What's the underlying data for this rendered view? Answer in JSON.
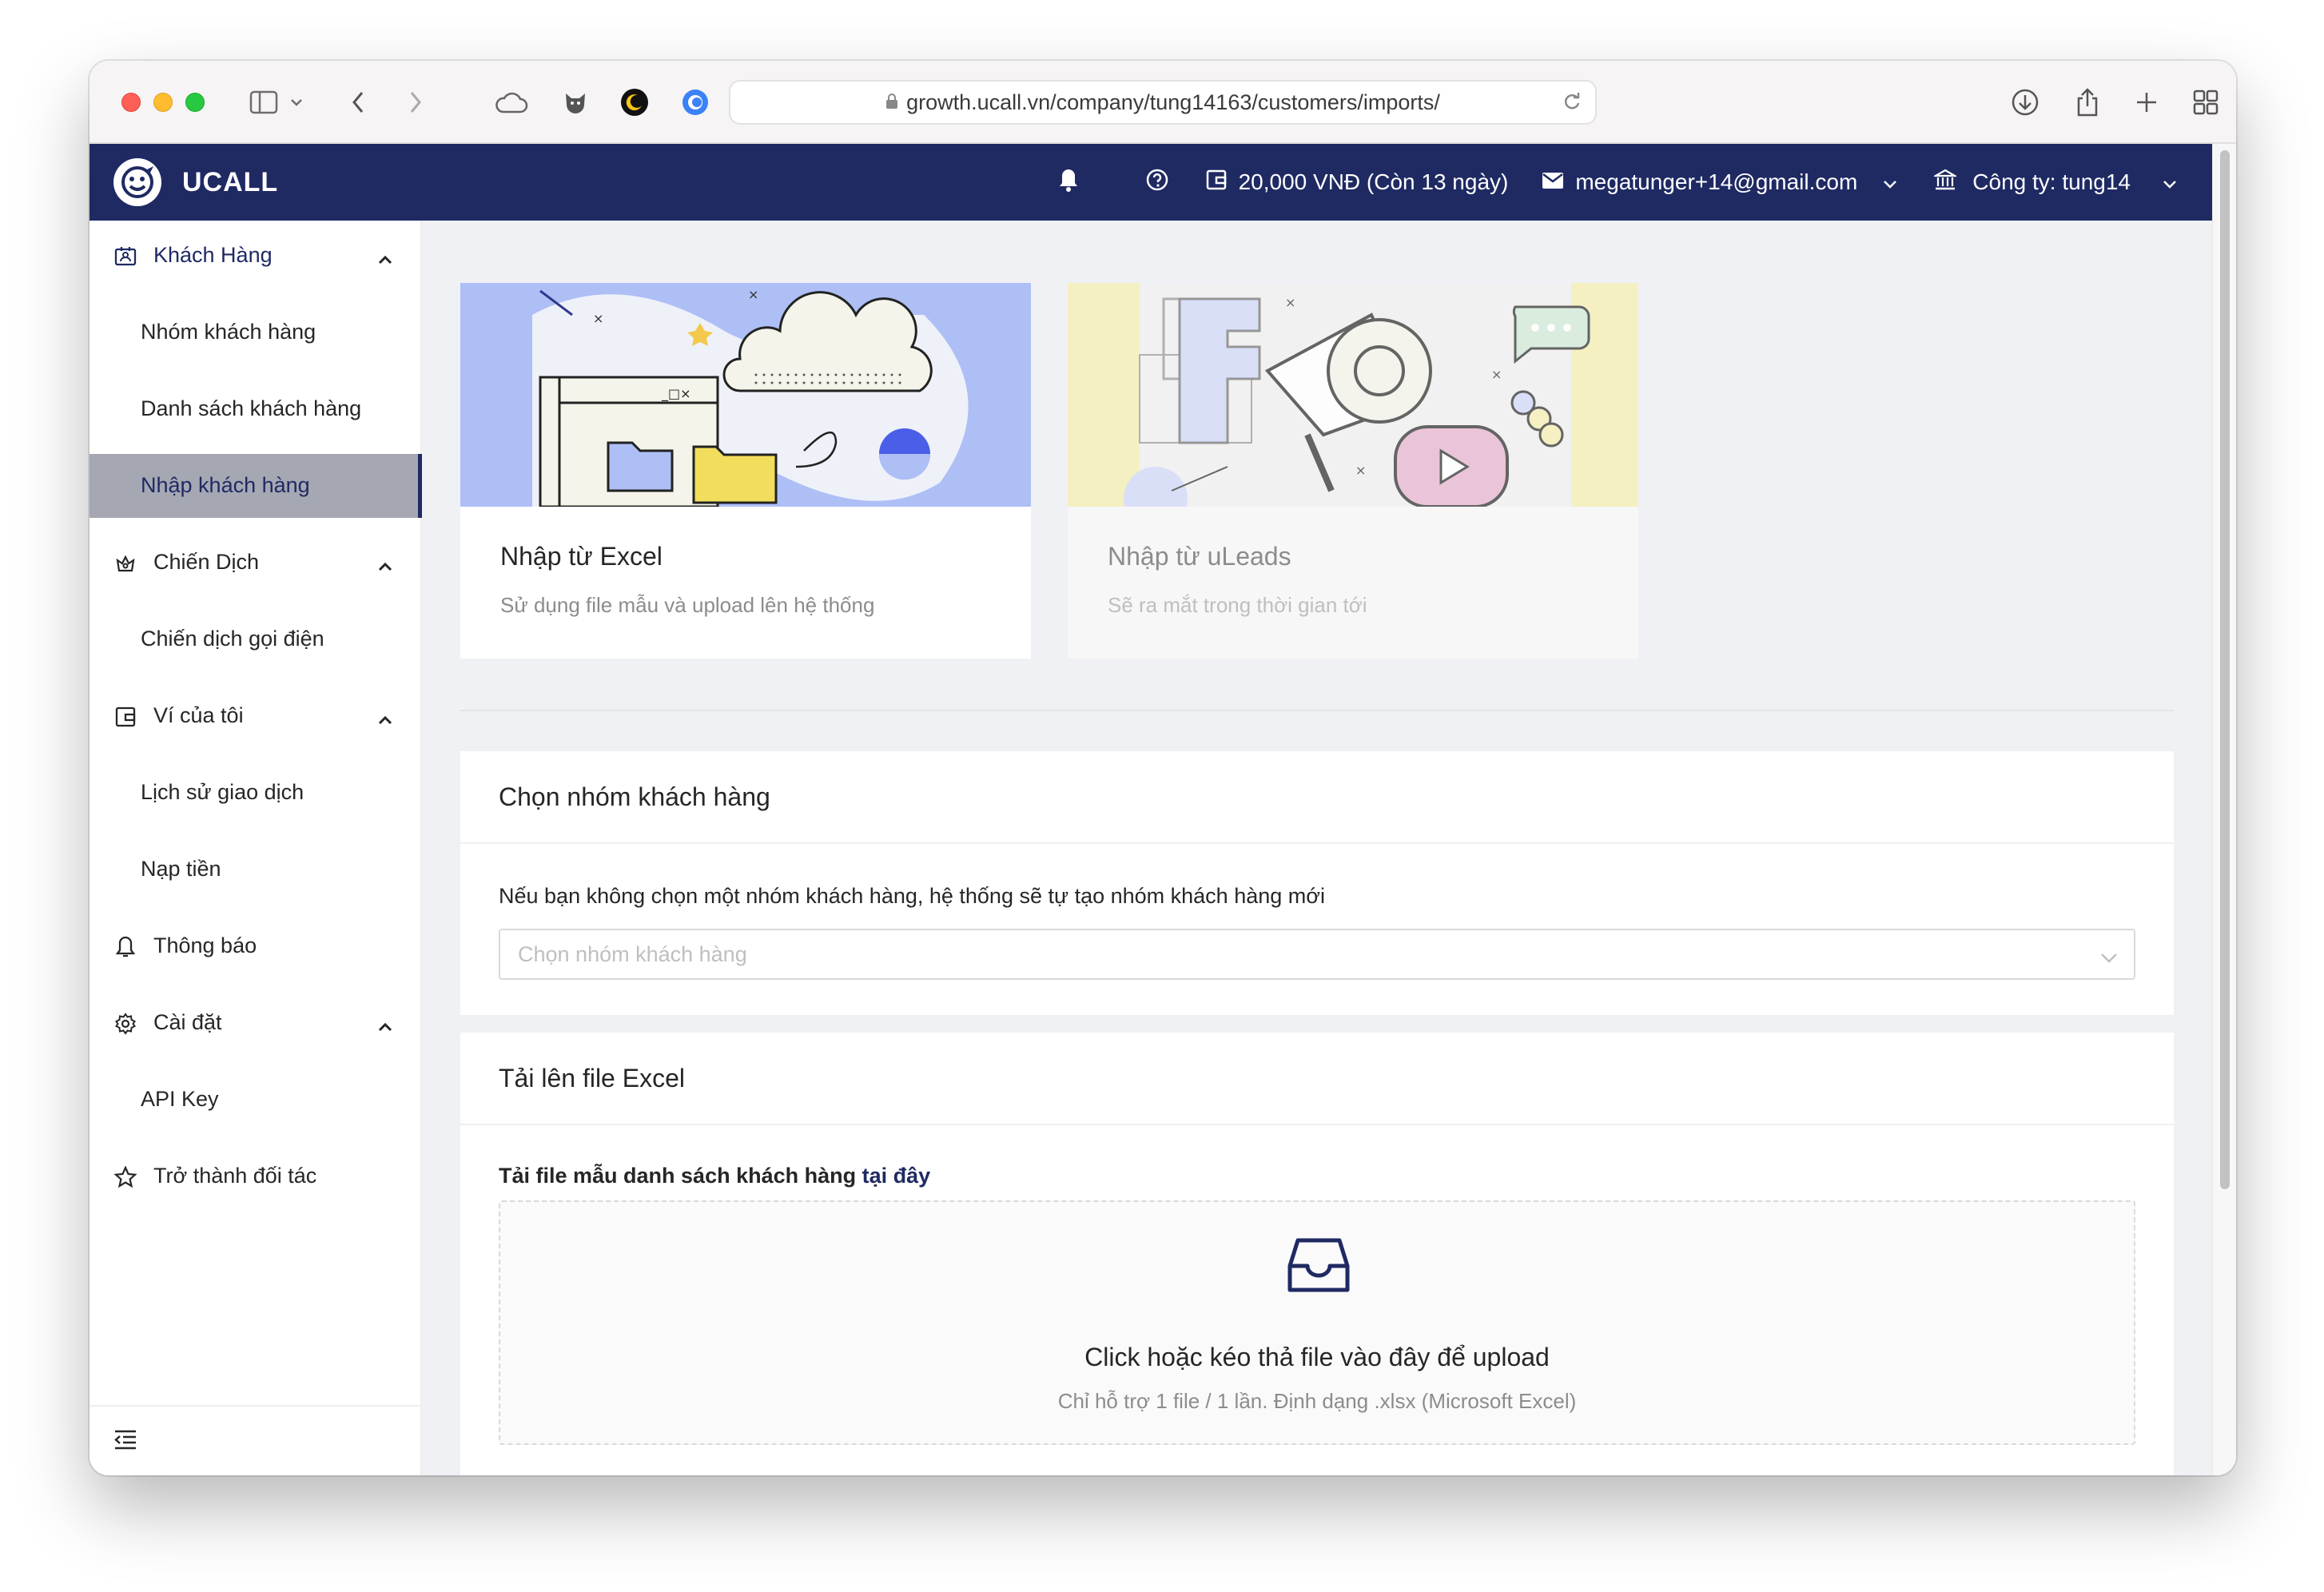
{
  "browser": {
    "url": "growth.ucall.vn/company/tung14163/customers/imports/"
  },
  "header": {
    "brand": "UCALL",
    "balance": "20,000 VNĐ (Còn 13 ngày)",
    "email": "megatunger+14@gmail.com",
    "company": "Công ty: tung14"
  },
  "sidebar": {
    "items": [
      {
        "label": "Khách Hàng",
        "icon": "contact-card-icon"
      },
      {
        "label": "Nhóm khách hàng"
      },
      {
        "label": "Danh sách khách hàng"
      },
      {
        "label": "Nhập khách hàng"
      },
      {
        "label": "Chiến Dịch",
        "icon": "campaign-icon"
      },
      {
        "label": "Chiến dịch gọi điện"
      },
      {
        "label": "Ví của tôi",
        "icon": "wallet-icon"
      },
      {
        "label": "Lịch sử giao dịch"
      },
      {
        "label": "Nạp tiền"
      },
      {
        "label": "Thông báo",
        "icon": "bell-icon"
      },
      {
        "label": "Cài đặt",
        "icon": "gear-icon"
      },
      {
        "label": "API Key"
      },
      {
        "label": "Trở thành đối tác",
        "icon": "star-icon"
      }
    ]
  },
  "cards": [
    {
      "title": "Nhập từ Excel",
      "desc": "Sử dụng file mẫu và upload lên hệ thống"
    },
    {
      "title": "Nhập từ uLeads",
      "desc": "Sẽ ra mắt trong thời gian tới"
    }
  ],
  "group_panel": {
    "title": "Chọn nhóm khách hàng",
    "note": "Nếu bạn không chọn một nhóm khách hàng, hệ thống sẽ tự tạo nhóm khách hàng mới",
    "placeholder": "Chọn nhóm khách hàng"
  },
  "upload_panel": {
    "title": "Tải lên file Excel",
    "download_text": "Tải file mẫu danh sách khách hàng",
    "download_link": "tại đây",
    "dz_title": "Click hoặc kéo thả file vào đây để upload",
    "dz_hint": "Chỉ hỗ trợ 1 file / 1 lần. Định dạng .xlsx (Microsoft Excel)"
  },
  "colors": {
    "brand": "#1f2a63",
    "content_bg": "#f0f1f5",
    "active_item_bg": "#a5a8b3"
  }
}
